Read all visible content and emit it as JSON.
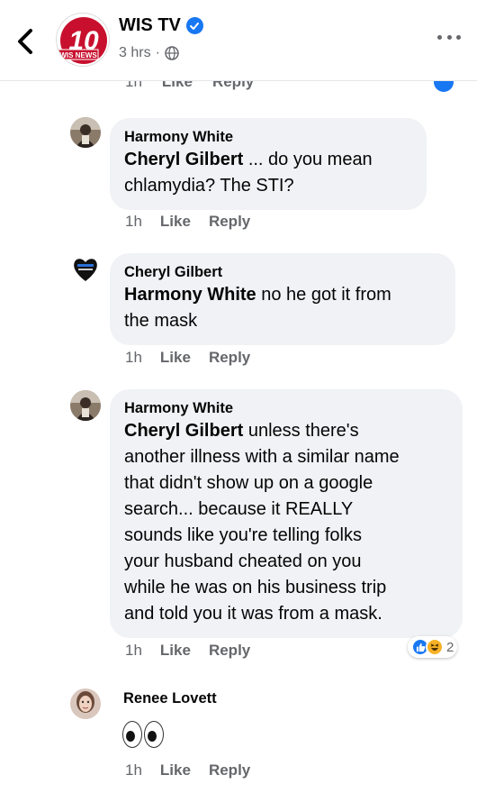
{
  "header": {
    "page_name": "WIS TV",
    "post_time": "3 hrs",
    "avatar_text": "10",
    "avatar_subtext": "WIS NEWS"
  },
  "clipped_actions": {
    "time": "1h",
    "like": "Like",
    "reply": "Reply"
  },
  "comments": [
    {
      "author": "Harmony White",
      "mention": "Cheryl Gilbert",
      "text_lines": [
        " ... do you mean",
        "chlamydia? The STI?"
      ],
      "time": "1h",
      "like": "Like",
      "reply": "Reply"
    },
    {
      "author": "Cheryl Gilbert",
      "mention": "Harmony White",
      "text_lines": [
        " no he got it from",
        "the mask"
      ],
      "time": "1h",
      "like": "Like",
      "reply": "Reply"
    },
    {
      "author": "Harmony White",
      "mention": "Cheryl Gilbert",
      "text_lines": [
        " unless there's",
        "another illness with a similar name",
        "that didn't show up on a google",
        "search... because it REALLY",
        "sounds like you're telling folks",
        "your husband cheated on you",
        "while he was on his business trip",
        "and told you it was from a mask."
      ],
      "time": "1h",
      "like": "Like",
      "reply": "Reply",
      "reaction_count": "2"
    },
    {
      "author": "Renee Lovett",
      "time": "1h",
      "like": "Like",
      "reply": "Reply"
    }
  ],
  "colors": {
    "facebook_blue": "#1877f2",
    "bubble_bg": "#f0f2f5",
    "secondary_text": "#65676b",
    "wis_red": "#c8102e"
  },
  "icons": {
    "back": "back-arrow-icon",
    "verified": "verified-check-icon",
    "audience": "globe-icon",
    "more": "more-dots-icon",
    "like_reaction": "like-reaction-icon",
    "haha_reaction": "haha-reaction-icon",
    "eyes": "eyes-emoji-icon"
  }
}
